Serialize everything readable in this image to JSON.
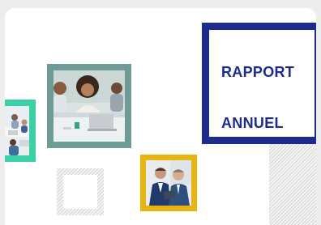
{
  "document": {
    "title_line1": "RAPPORT",
    "title_line2": "ANNUEL"
  },
  "colors": {
    "title_frame": "#1d2b8e",
    "teal_frame": "#6e9b95",
    "mint_frame": "#3ad1a6",
    "gold_frame": "#e7b50f",
    "hatch": "#d6d6d6"
  },
  "images": [
    {
      "name": "team-meeting-photo",
      "frame_color": "teal"
    },
    {
      "name": "laptop-meeting-photo",
      "frame_color": "mint"
    },
    {
      "name": "businessmen-tablet-photo",
      "frame_color": "gold"
    }
  ]
}
